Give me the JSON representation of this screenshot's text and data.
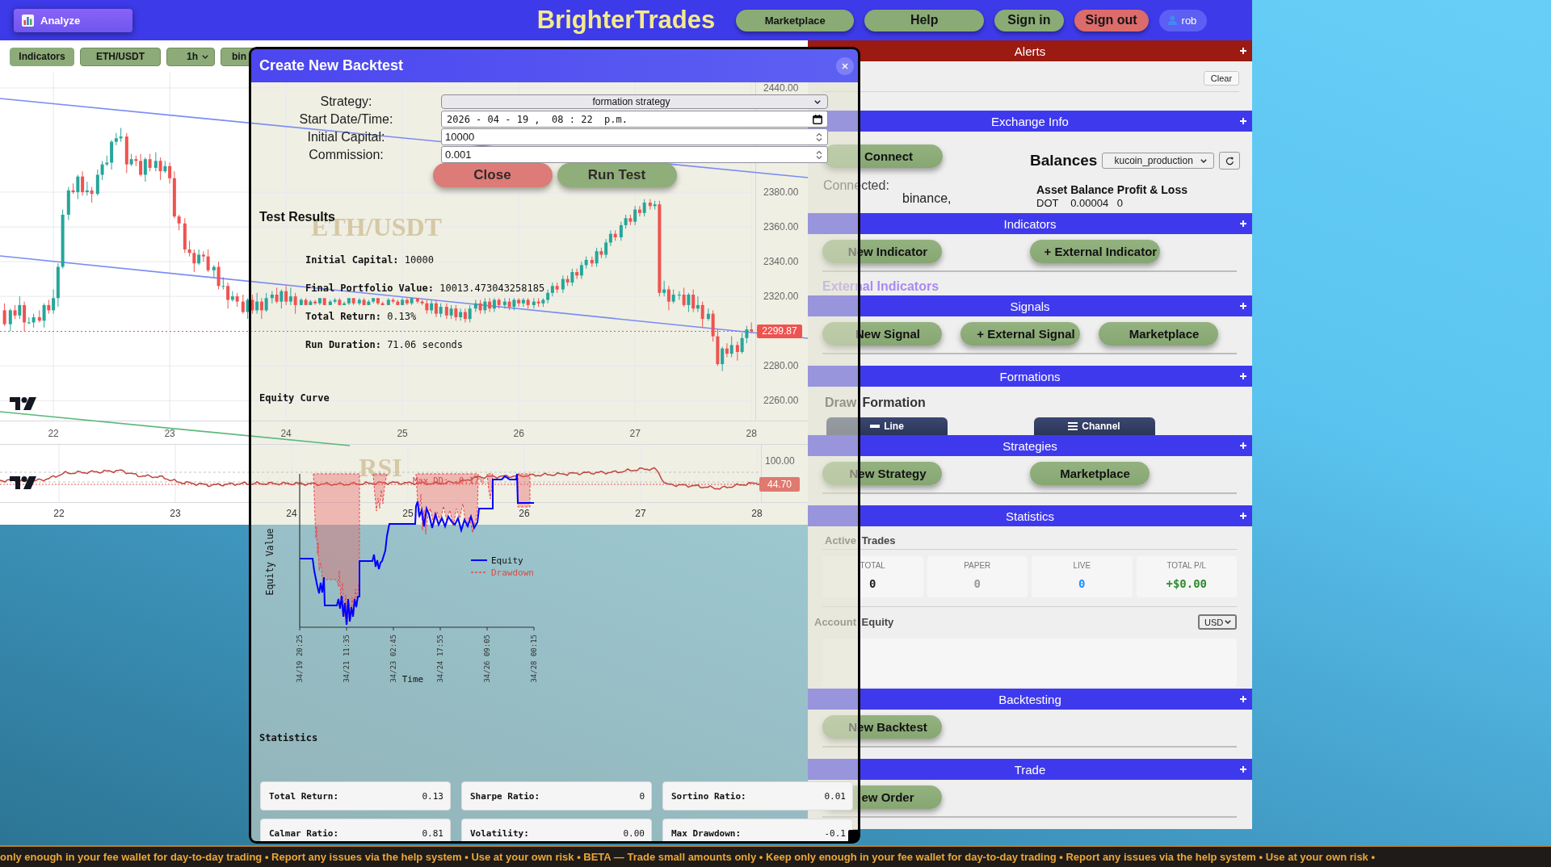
{
  "top_bar": {
    "analyze_button": "Analyze",
    "title": "BrighterTrades",
    "nav_buttons": [
      {
        "label": "Marketplace",
        "kind": "compact"
      },
      {
        "label": "Help",
        "kind": "wide"
      },
      {
        "label": "Sign in",
        "kind": "plain"
      },
      {
        "label": "Sign out",
        "kind": "danger"
      }
    ],
    "user": "rob"
  },
  "chart_toolbar": {
    "indicators_button": "Indicators",
    "symbol": "ETH/USDT",
    "timeframe": "1h",
    "exchange": "bin"
  },
  "price_chart": {
    "watermark": "ETH/USDT",
    "chart_data": {
      "type": "candlestick",
      "grid": true,
      "x": [
        21.58,
        21.63,
        21.67,
        21.71,
        21.75,
        21.79,
        21.83,
        21.88,
        21.92,
        21.96,
        22,
        22.04,
        22.08,
        22.13,
        22.17,
        22.21,
        22.25,
        22.29,
        22.33,
        22.38,
        22.42,
        22.46,
        22.5,
        22.54,
        22.58,
        22.63,
        22.67,
        22.71,
        22.75,
        22.79,
        22.83,
        22.88,
        22.92,
        22.96,
        23,
        23.04,
        23.08,
        23.13,
        23.17,
        23.21,
        23.25,
        23.29,
        23.33,
        23.38,
        23.42,
        23.46,
        23.5,
        23.54,
        23.58,
        23.63,
        23.67,
        23.71,
        23.75,
        23.79,
        23.83,
        23.88,
        23.92,
        23.96,
        24,
        24.04,
        24.08,
        24.13,
        24.17,
        24.21,
        24.25,
        24.29,
        24.33,
        24.38,
        24.42,
        24.46,
        24.5,
        24.54,
        24.58,
        24.63,
        24.67,
        24.71,
        24.75,
        24.79,
        24.83,
        24.88,
        24.92,
        24.96,
        25,
        25.04,
        25.08,
        25.13,
        25.17,
        25.21,
        25.25,
        25.29,
        25.33,
        25.38,
        25.42,
        25.46,
        25.5,
        25.54,
        25.58,
        25.63,
        25.67,
        25.71,
        25.75,
        25.79,
        25.83,
        25.88,
        25.92,
        25.96,
        26,
        26.04,
        26.08,
        26.13,
        26.17,
        26.21,
        26.25,
        26.29,
        26.33,
        26.38,
        26.42,
        26.46,
        26.5,
        26.54,
        26.58,
        26.63,
        26.67,
        26.71,
        26.75,
        26.79,
        26.83,
        26.88,
        26.92,
        26.96,
        27,
        27.04,
        27.08,
        27.13,
        27.17,
        27.21,
        27.25,
        27.29,
        27.33,
        27.38,
        27.42,
        27.46,
        27.5,
        27.54,
        27.58,
        27.63,
        27.67,
        27.71,
        27.75,
        27.79,
        27.83,
        27.88,
        27.92,
        27.96,
        28
      ],
      "ohlc": [
        [
          2312,
          2316,
          2303,
          2304
        ],
        [
          2304,
          2313,
          2300,
          2312
        ],
        [
          2312,
          2315,
          2307,
          2309
        ],
        [
          2309,
          2320,
          2307,
          2315
        ],
        [
          2315,
          2317,
          2300,
          2305
        ],
        [
          2305,
          2308,
          2304,
          2305
        ],
        [
          2305,
          2310,
          2302,
          2308
        ],
        [
          2308,
          2312,
          2305,
          2306
        ],
        [
          2306,
          2316,
          2302,
          2315
        ],
        [
          2315,
          2318,
          2310,
          2312
        ],
        [
          2312,
          2324,
          2310,
          2319
        ],
        [
          2319,
          2339,
          2314,
          2337
        ],
        [
          2337,
          2370,
          2336,
          2367
        ],
        [
          2367,
          2383,
          2364,
          2381
        ],
        [
          2381,
          2385,
          2379,
          2380
        ],
        [
          2380,
          2390,
          2376,
          2389
        ],
        [
          2389,
          2392,
          2378,
          2380
        ],
        [
          2380,
          2386,
          2378,
          2381
        ],
        [
          2381,
          2383,
          2374,
          2379
        ],
        [
          2379,
          2393,
          2378,
          2390
        ],
        [
          2390,
          2398,
          2387,
          2396
        ],
        [
          2396,
          2401,
          2395,
          2397
        ],
        [
          2397,
          2410,
          2393,
          2409
        ],
        [
          2409,
          2414,
          2407,
          2411
        ],
        [
          2411,
          2417,
          2409,
          2412
        ],
        [
          2412,
          2414,
          2391,
          2396
        ],
        [
          2396,
          2402,
          2395,
          2399
        ],
        [
          2399,
          2401,
          2395,
          2398
        ],
        [
          2398,
          2402,
          2389,
          2390
        ],
        [
          2390,
          2400,
          2386,
          2399
        ],
        [
          2399,
          2402,
          2392,
          2394
        ],
        [
          2394,
          2403,
          2392,
          2398
        ],
        [
          2398,
          2400,
          2387,
          2392
        ],
        [
          2392,
          2398,
          2391,
          2395
        ],
        [
          2395,
          2397,
          2385,
          2388
        ],
        [
          2388,
          2392,
          2365,
          2366
        ],
        [
          2366,
          2367,
          2358,
          2362
        ],
        [
          2362,
          2365,
          2345,
          2347
        ],
        [
          2347,
          2352,
          2343,
          2345
        ],
        [
          2345,
          2347,
          2334,
          2339
        ],
        [
          2339,
          2347,
          2338,
          2344
        ],
        [
          2344,
          2346,
          2340,
          2343
        ],
        [
          2343,
          2347,
          2334,
          2335
        ],
        [
          2335,
          2338,
          2331,
          2337
        ],
        [
          2337,
          2340,
          2324,
          2326
        ],
        [
          2326,
          2331,
          2324,
          2326
        ],
        [
          2326,
          2328,
          2313,
          2318
        ],
        [
          2318,
          2323,
          2317,
          2320
        ],
        [
          2320,
          2322,
          2314,
          2317
        ],
        [
          2317,
          2321,
          2310,
          2311
        ],
        [
          2311,
          2319,
          2307,
          2318
        ],
        [
          2318,
          2321,
          2310,
          2312
        ],
        [
          2312,
          2322,
          2310,
          2317
        ],
        [
          2317,
          2319,
          2307,
          2312
        ],
        [
          2312,
          2322,
          2311,
          2319
        ],
        [
          2319,
          2323,
          2316,
          2321
        ],
        [
          2321,
          2325,
          2316,
          2317
        ],
        [
          2317,
          2324,
          2313,
          2323
        ],
        [
          2323,
          2326,
          2315,
          2317
        ],
        [
          2317,
          2325,
          2315,
          2320
        ],
        [
          2320,
          2322,
          2310,
          2315
        ],
        [
          2315,
          2319,
          2315,
          2318
        ],
        [
          2318,
          2319,
          2315,
          2315
        ],
        [
          2315,
          2318,
          2315,
          2317
        ],
        [
          2317,
          2318,
          2315,
          2316
        ],
        [
          2316,
          2319,
          2315,
          2319
        ],
        [
          2319,
          2319,
          2315,
          2315
        ],
        [
          2315,
          2318,
          2315,
          2317
        ],
        [
          2317,
          2319,
          2316,
          2318
        ],
        [
          2318,
          2319,
          2315,
          2315
        ],
        [
          2315,
          2317,
          2315,
          2316
        ],
        [
          2316,
          2319,
          2315,
          2319
        ],
        [
          2319,
          2319,
          2315,
          2316
        ],
        [
          2316,
          2319,
          2315,
          2318
        ],
        [
          2318,
          2319,
          2315,
          2315
        ],
        [
          2315,
          2318,
          2315,
          2317
        ],
        [
          2317,
          2319,
          2316,
          2319
        ],
        [
          2319,
          2319,
          2315,
          2316
        ],
        [
          2316,
          2317,
          2315,
          2315
        ],
        [
          2315,
          2319,
          2315,
          2318
        ],
        [
          2318,
          2319,
          2316,
          2317
        ],
        [
          2317,
          2318,
          2315,
          2315
        ],
        [
          2315,
          2319,
          2315,
          2318
        ],
        [
          2318,
          2319,
          2315,
          2316
        ],
        [
          2316,
          2319,
          2315,
          2319
        ],
        [
          2319,
          2319,
          2316,
          2317
        ],
        [
          2317,
          2318,
          2315,
          2316
        ],
        [
          2316,
          2318,
          2310,
          2312
        ],
        [
          2312,
          2318,
          2310,
          2316
        ],
        [
          2316,
          2318,
          2308,
          2310
        ],
        [
          2310,
          2316,
          2308,
          2314
        ],
        [
          2314,
          2316,
          2307,
          2309
        ],
        [
          2309,
          2315,
          2307,
          2313
        ],
        [
          2313,
          2315,
          2306,
          2308
        ],
        [
          2308,
          2313,
          2306,
          2311
        ],
        [
          2311,
          2313,
          2305,
          2307
        ],
        [
          2307,
          2315,
          2305,
          2313
        ],
        [
          2313,
          2318,
          2311,
          2316
        ],
        [
          2316,
          2318,
          2310,
          2312
        ],
        [
          2312,
          2319,
          2310,
          2317
        ],
        [
          2317,
          2319,
          2311,
          2313
        ],
        [
          2313,
          2319,
          2311,
          2318
        ],
        [
          2318,
          2319,
          2313,
          2315
        ],
        [
          2315,
          2319,
          2313,
          2317
        ],
        [
          2317,
          2319,
          2312,
          2314
        ],
        [
          2314,
          2319,
          2312,
          2318
        ],
        [
          2318,
          2319,
          2314,
          2316
        ],
        [
          2316,
          2319,
          2314,
          2318
        ],
        [
          2318,
          2319,
          2313,
          2315
        ],
        [
          2315,
          2319,
          2313,
          2317
        ],
        [
          2317,
          2319,
          2314,
          2316
        ],
        [
          2316,
          2319,
          2314,
          2318
        ],
        [
          2318,
          2324,
          2316,
          2322
        ],
        [
          2322,
          2328,
          2320,
          2326
        ],
        [
          2326,
          2328,
          2322,
          2324
        ],
        [
          2324,
          2332,
          2322,
          2330
        ],
        [
          2330,
          2332,
          2326,
          2328
        ],
        [
          2328,
          2336,
          2326,
          2334
        ],
        [
          2334,
          2336,
          2330,
          2332
        ],
        [
          2332,
          2340,
          2330,
          2338
        ],
        [
          2338,
          2343,
          2336,
          2341
        ],
        [
          2341,
          2343,
          2337,
          2339
        ],
        [
          2339,
          2348,
          2337,
          2346
        ],
        [
          2346,
          2348,
          2342,
          2344
        ],
        [
          2344,
          2353,
          2342,
          2351
        ],
        [
          2351,
          2358,
          2349,
          2356
        ],
        [
          2356,
          2358,
          2352,
          2354
        ],
        [
          2354,
          2363,
          2352,
          2361
        ],
        [
          2361,
          2367,
          2359,
          2365
        ],
        [
          2365,
          2367,
          2361,
          2363
        ],
        [
          2363,
          2372,
          2361,
          2370
        ],
        [
          2370,
          2372,
          2366,
          2368
        ],
        [
          2368,
          2376,
          2366,
          2374
        ],
        [
          2374,
          2376,
          2370,
          2372
        ],
        [
          2372,
          2375,
          2370,
          2373
        ],
        [
          2373,
          2375,
          2320,
          2322
        ],
        [
          2322,
          2329,
          2320,
          2324
        ],
        [
          2324,
          2326,
          2312,
          2317
        ],
        [
          2317,
          2324,
          2316,
          2321
        ],
        [
          2321,
          2323,
          2318,
          2321
        ],
        [
          2321,
          2325,
          2314,
          2315
        ],
        [
          2315,
          2322,
          2311,
          2321
        ],
        [
          2321,
          2324,
          2311,
          2313
        ],
        [
          2313,
          2320,
          2311,
          2315
        ],
        [
          2315,
          2317,
          2302,
          2307
        ],
        [
          2307,
          2313,
          2306,
          2310
        ],
        [
          2310,
          2312,
          2294,
          2297
        ],
        [
          2297,
          2301,
          2280,
          2281
        ],
        [
          2281,
          2291,
          2277,
          2290
        ],
        [
          2290,
          2293,
          2285,
          2287
        ],
        [
          2287,
          2297,
          2285,
          2292
        ],
        [
          2292,
          2294,
          2283,
          2288
        ],
        [
          2288,
          2299,
          2287,
          2296
        ],
        [
          2296,
          2303,
          2293,
          2301
        ],
        [
          2301,
          2305,
          2299,
          2300
        ]
      ],
      "xlim": [
        21.541,
        28.485
      ],
      "ylim": [
        2248.5,
        2448.8
      ],
      "xticks": [
        {
          "value": 22,
          "label": "22"
        },
        {
          "value": 23,
          "label": "23"
        },
        {
          "value": 24,
          "label": "24"
        },
        {
          "value": 25,
          "label": "25"
        },
        {
          "value": 26,
          "label": "26"
        },
        {
          "value": 27,
          "label": "27"
        },
        {
          "value": 28,
          "label": "28"
        }
      ],
      "yticks": [
        {
          "value": 2440,
          "label": "2440.00"
        },
        {
          "value": 2380,
          "label": "2380.00"
        },
        {
          "value": 2360,
          "label": "2360.00"
        },
        {
          "value": 2340,
          "label": "2340.00"
        },
        {
          "value": 2320,
          "label": "2320.00"
        },
        {
          "value": 2280,
          "label": "2280.00"
        },
        {
          "value": 2260,
          "label": "2260.00"
        }
      ],
      "ref_lines": [
        {
          "axis": "y",
          "value": 2299.87,
          "label": "2299.87"
        }
      ]
    }
  },
  "rsi_pane": {
    "watermark": "RSI",
    "top_label": "100.00",
    "value_label": "44.70",
    "time_labels": [
      "22",
      "23",
      "24",
      "25",
      "26",
      "27",
      "28"
    ]
  },
  "backtest_dialog": {
    "title": "Create New Backtest",
    "form": [
      {
        "label": "Strategy:",
        "kind": "select",
        "value": "formation strategy"
      },
      {
        "label": "Start Date/Time:",
        "kind": "datetime",
        "value": "2026 - 04 - 19 ,  08 : 22  p.m."
      },
      {
        "label": "Initial Capital:",
        "kind": "number",
        "value": "10000"
      },
      {
        "label": "Commission:",
        "kind": "number",
        "value": "0.001"
      }
    ],
    "buttons": [
      {
        "label": "Close",
        "kind": "cancel"
      },
      {
        "label": "Run Test",
        "kind": "run"
      }
    ],
    "results_title": "Test Results",
    "results": [
      "**Initial Capital:** 10000",
      "**Final Portfolio Value:** 10013.473043258185",
      "**Total Return:** 0.13%",
      "**Run Duration:** 71.06 seconds"
    ],
    "equity_chart": {
      "title": "Equity Curve",
      "y_axis_title": "Equity Value",
      "x_axis_title": "Time",
      "x_tick_labels": [
        "34/19 20:25",
        "34/21 11:35",
        "34/23 02:45",
        "34/24 17:55",
        "34/26 09:05",
        "34/28 00:15"
      ],
      "legend": [
        {
          "label": "Equity",
          "kind": "solid"
        },
        {
          "label": "Drawdown",
          "kind": "dashed"
        }
      ],
      "annotation": "Max DD: -0.17%"
    },
    "statistics_title": "Statistics",
    "statistics": [
      {
        "label": "Total Return:",
        "value": "0.13"
      },
      {
        "label": "Sharpe Ratio:",
        "value": "0"
      },
      {
        "label": "Sortino Ratio:",
        "value": "0.01"
      },
      {
        "label": "Calmar Ratio:",
        "value": "0.81"
      },
      {
        "label": "Volatility:",
        "value": "0.00"
      },
      {
        "label": "Max Drawdown:",
        "value": "-0.1"
      }
    ]
  },
  "sidebar": {
    "sections": [
      {
        "title": "Alerts",
        "color": "#9b1a12",
        "kind": "alerts",
        "clear_button": "Clear"
      },
      {
        "title": "Exchange Info",
        "color": "#3f39ee",
        "kind": "exchange",
        "connect_button": "Connect",
        "connected_label": "Connected:",
        "connected_exchanges": [
          "binance,"
        ],
        "balances_title": "Balances",
        "account": "kucoin_production",
        "balance_table": {
          "columns": [
            "Asset",
            "Balance",
            "Profit & Loss"
          ],
          "rows": [
            [
              "DOT",
              "0.00004",
              "0"
            ]
          ]
        }
      },
      {
        "title": "Indicators",
        "color": "#3f39ee",
        "kind": "buttons",
        "buttons": [
          "New Indicator",
          "+ External Indicator"
        ],
        "subheading": "External Indicators"
      },
      {
        "title": "Signals",
        "color": "#3f39ee",
        "kind": "buttons",
        "buttons": [
          "New Signal",
          "+ External Signal",
          "Marketplace"
        ]
      },
      {
        "title": "Formations",
        "color": "#3f39ee",
        "kind": "formations",
        "heading": "Draw Formation",
        "tools": [
          {
            "label": "Line",
            "kind": "line"
          },
          {
            "label": "Channel",
            "kind": "channel"
          }
        ]
      },
      {
        "title": "Strategies",
        "color": "#3f39ee",
        "kind": "buttons",
        "buttons": [
          "New Strategy",
          "Marketplace"
        ]
      },
      {
        "title": "Statistics",
        "color": "#3f39ee",
        "kind": "statistics",
        "active_trades_title": "Active Trades",
        "counters": [
          {
            "label": "TOTAL",
            "value": "0",
            "color": "#222222"
          },
          {
            "label": "PAPER",
            "value": "0",
            "color": "#9a9a9a"
          },
          {
            "label": "LIVE",
            "value": "0",
            "color": "#1e90ff"
          },
          {
            "label": "TOTAL P/L",
            "value": "+$0.00",
            "color": "#2e8b2e"
          }
        ],
        "equity_title": "Account Equity",
        "currency": "USD"
      },
      {
        "title": "Backtesting",
        "color": "#3f39ee",
        "kind": "buttons",
        "buttons": [
          "New Backtest"
        ]
      },
      {
        "title": "Trade",
        "color": "#3f39ee",
        "kind": "buttons",
        "buttons": [
          "ew Order"
        ]
      }
    ]
  },
  "ticker": "only enough in your fee wallet for day-to-day trading • Report any issues via the help system • Use at your own risk • BETA — Trade small amounts only • Keep only enough in your fee wallet for day-to-day trading • Report any issues via the help system • Use at your own risk •"
}
